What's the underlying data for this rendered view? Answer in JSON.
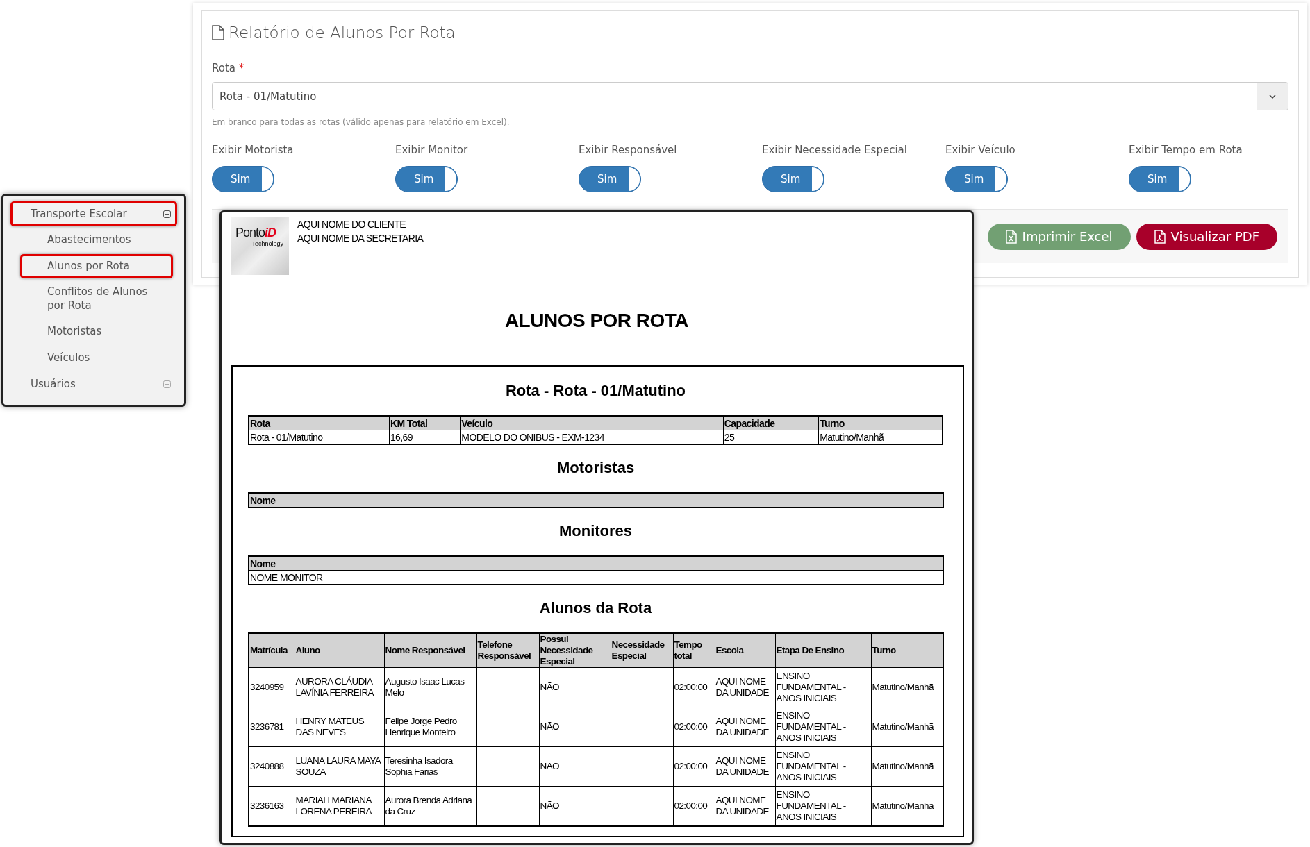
{
  "panel": {
    "title": "Relatório de Alunos Por Rota",
    "route_field": {
      "label": "Rota",
      "required_mark": "*",
      "value": "Rota - 01/Matutino",
      "hint": "Em branco para todas as rotas (válido apenas para relatório em Excel)."
    },
    "toggles": [
      {
        "label": "Exibir Motorista",
        "text": "Sim",
        "on": true
      },
      {
        "label": "Exibir Monitor",
        "text": "Sim",
        "on": true
      },
      {
        "label": "Exibir Responsável",
        "text": "Sim",
        "on": true
      },
      {
        "label": "Exibir Necessidade Especial",
        "text": "Sim",
        "on": true
      },
      {
        "label": "Exibir Veículo",
        "text": "Sim",
        "on": true
      },
      {
        "label": "Exibir Tempo em Rota",
        "text": "Sim",
        "on": true
      }
    ],
    "buttons": [
      {
        "kind": "excel",
        "label": "Imprimir Excel"
      },
      {
        "kind": "pdf",
        "label": "Visualizar PDF"
      }
    ]
  },
  "sidebar": {
    "items": [
      {
        "label": "Transporte Escolar",
        "expanded": true,
        "highlighted": true,
        "children": [
          {
            "label": "Abastecimentos",
            "highlighted": false
          },
          {
            "label": "Alunos por Rota",
            "highlighted": true
          },
          {
            "label": "Conflitos de Alunos por Rota",
            "highlighted": false
          },
          {
            "label": "Motoristas",
            "highlighted": false
          },
          {
            "label": "Veículos",
            "highlighted": false
          }
        ]
      },
      {
        "label": "Usuários",
        "expanded": false,
        "highlighted": false
      }
    ]
  },
  "report": {
    "logo": {
      "name": "Ponto",
      "accent": "iD",
      "tagline": "Technology"
    },
    "header_lines": [
      "AQUI NOME DO CLIENTE",
      "AQUI NOME DA SECRETARIA"
    ],
    "title": "ALUNOS POR ROTA",
    "route_heading": "Rota - Rota - 01/Matutino",
    "route_table": {
      "columns": [
        "Rota",
        "KM Total",
        "Veículo",
        "Capacidade",
        "Turno"
      ],
      "rows": [
        [
          "Rota - 01/Matutino",
          "16,69",
          "MODELO DO ONIBUS - EXM-1234",
          "25",
          "Matutino/Manhã"
        ]
      ]
    },
    "sections": [
      {
        "heading": "Motoristas",
        "columns": [
          "Nome"
        ]
      },
      {
        "heading": "Monitores",
        "columns": [
          "Nome"
        ],
        "rows": [
          [
            "NOME MONITOR"
          ]
        ]
      }
    ],
    "students": {
      "heading": "Alunos da Rota",
      "columns": [
        "Matrícula",
        "Aluno",
        "Nome Responsável",
        "Telefone Responsável",
        "Possui Necessidade Especial",
        "Necessidade Especial",
        "Tempo total",
        "Escola",
        "Etapa De Ensino",
        "Turno"
      ],
      "rows": [
        [
          "3240959",
          "AURORA CLÁUDIA LAVÍNIA FERREIRA",
          "Augusto Isaac Lucas Melo",
          "",
          "NÃO",
          "",
          "02:00:00",
          "AQUI NOME DA UNIDADE",
          "ENSINO FUNDAMENTAL - ANOS INICIAIS",
          "Matutino/Manhã"
        ],
        [
          "3236781",
          "HENRY MATEUS DAS NEVES",
          "Felipe Jorge Pedro Henrique Monteiro",
          "",
          "NÃO",
          "",
          "02:00:00",
          "AQUI NOME DA UNIDADE",
          "ENSINO FUNDAMENTAL - ANOS INICIAIS",
          "Matutino/Manhã"
        ],
        [
          "3240888",
          "LUANA LAURA MAYA SOUZA",
          "Teresinha Isadora Sophia Farias",
          "",
          "NÃO",
          "",
          "02:00:00",
          "AQUI NOME DA UNIDADE",
          "ENSINO FUNDAMENTAL - ANOS INICIAIS",
          "Matutino/Manhã"
        ],
        [
          "3236163",
          "MARIAH MARIANA LORENA PEREIRA",
          "Aurora Brenda Adriana da Cruz",
          "",
          "NÃO",
          "",
          "02:00:00",
          "AQUI NOME DA UNIDADE",
          "ENSINO FUNDAMENTAL - ANOS INICIAIS",
          "Matutino/Manhã"
        ]
      ]
    }
  }
}
